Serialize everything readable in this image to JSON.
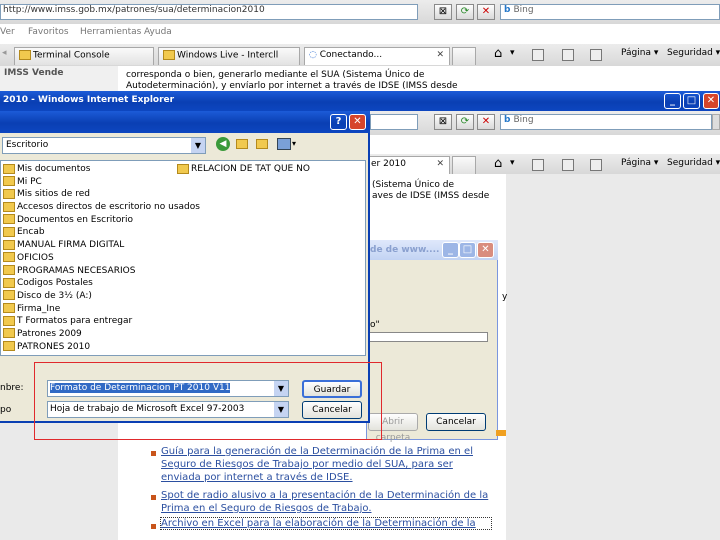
{
  "browser_back": {
    "address_url": "http://www.imss.gob.mx/patrones/sua/determinacion2010",
    "search_text": "Bing",
    "menu_items": [
      "Ver",
      "Favoritos",
      "Herramientas",
      "Ayuda"
    ],
    "tabs": [
      "Terminal Console",
      "Windows Live - Intercll",
      "Conectando..."
    ],
    "tools": [
      "Página",
      "Seguridad"
    ],
    "sidebar_text": "IMSS Vende",
    "content_lines": [
      "corresponda o bien, generarlo mediante el SUA (Sistema Único de",
      "Autodeterminación), y envíarlo por internet a través de IDSE (IMSS desde"
    ]
  },
  "ie_window": {
    "title": "2010 - Windows Internet Explorer",
    "tab_label": "er 2010",
    "content_lines": [
      "(Sistema Único de",
      "aves de IDSE (IMSS desde"
    ],
    "search_text": "Bing",
    "tools": [
      "Página",
      "Seguridad"
    ]
  },
  "download_dialog": {
    "title": "de de www....",
    "field_label": "o\"",
    "button_label": "Cancelar",
    "disabled_label": "Abrir carpeta"
  },
  "save_dialog": {
    "location": "Escritorio",
    "items_left": [
      "Mis documentos",
      "Mi PC",
      "Mis sitios de red",
      "Accesos directos de escritorio no usados",
      "Documentos en Escritorio",
      "Encab",
      "MANUAL FIRMA DIGITAL",
      "OFICIOS",
      "PROGRAMAS NECESARIOS",
      "Codigos Postales",
      "Disco de 3½ (A:)",
      "Firma_Ine",
      "T Formatos para entregar",
      "Patrones 2009",
      "PATRONES 2010"
    ],
    "items_right": [
      "RELACION DE TAT QUE NO"
    ],
    "filename_label": "nbre:",
    "filename_value": "Formato de Determinacion PT 2010 V11",
    "type_label": "po",
    "type_value": "Hoja de trabajo de Microsoft Excel 97-2003",
    "save_button": "Guardar",
    "cancel_button": "Cancelar"
  },
  "page_links": [
    "Guía para la generación de la Determinación de la Prima en el Seguro de Riesgos de Trabajo por medio del SUA, para ser enviada por internet a través de IDSE.",
    "Spot de radio alusivo a la presentación de la Determinación de la Prima en el Seguro de Riesgos de Trabajo.",
    "Archivo en Excel para la elaboración de la Determinación de la"
  ],
  "right_fragment": "y",
  "colors": {
    "highlight": "#e0292c",
    "xp_blue": "#0a3fb3",
    "link": "#2b4fa0",
    "bullet": "#c8541b"
  }
}
